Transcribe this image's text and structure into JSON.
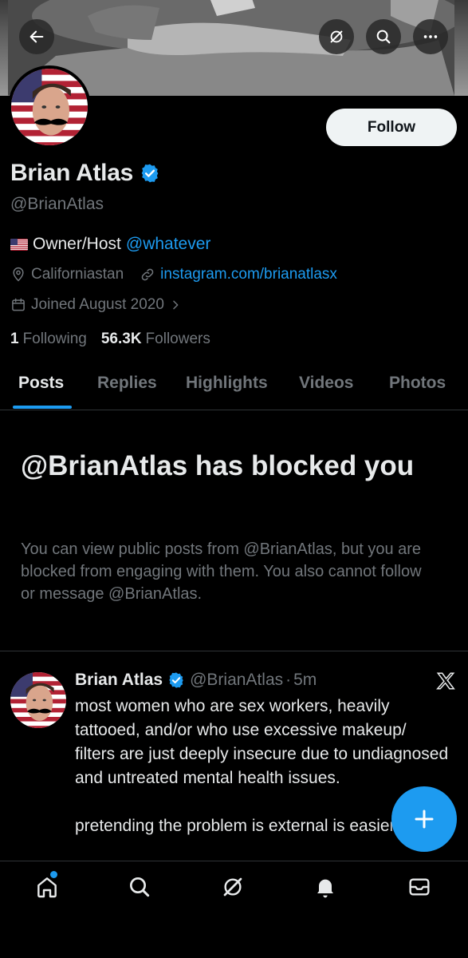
{
  "header": {
    "back_icon": "arrow-left-icon",
    "grok_icon": "grok-icon",
    "search_icon": "search-icon",
    "more_icon": "more-dots-icon"
  },
  "profile": {
    "name": "Brian Atlas",
    "handle": "@BrianAtlas",
    "follow_label": "Follow",
    "bio_text": "Owner/Host",
    "bio_link": "@whatever",
    "location": "Californiastan",
    "website": "instagram.com/brianatlasx",
    "joined": "Joined August 2020",
    "following_count": "1",
    "following_label": "Following",
    "followers_count": "56.3K",
    "followers_label": "Followers"
  },
  "tabs": [
    {
      "label": "Posts",
      "active": true
    },
    {
      "label": "Replies"
    },
    {
      "label": "Highlights"
    },
    {
      "label": "Videos"
    },
    {
      "label": "Photos"
    }
  ],
  "blocked": {
    "title": "@BrianAtlas has blocked you",
    "message": "You can view public posts from @BrianAtlas, but you are blocked from engaging with them. You also cannot follow or message @BrianAtlas."
  },
  "post": {
    "name": "Brian Atlas",
    "handle": "@BrianAtlas",
    "separator": "·",
    "time": "5m",
    "text": "most women who are sex workers, heavily tattooed, and/or who use excessive makeup/ filters are just deeply insecure due to undiagnosed and untreated mental health issues.\n\npretending the problem is external is easier"
  },
  "bottom_nav": [
    "home-icon",
    "search-icon",
    "grok-icon",
    "notifications-icon",
    "messages-icon"
  ],
  "colors": {
    "accent": "#1d9bf0",
    "text": "#e7e9ea",
    "muted": "#71767b",
    "background": "#000000"
  }
}
